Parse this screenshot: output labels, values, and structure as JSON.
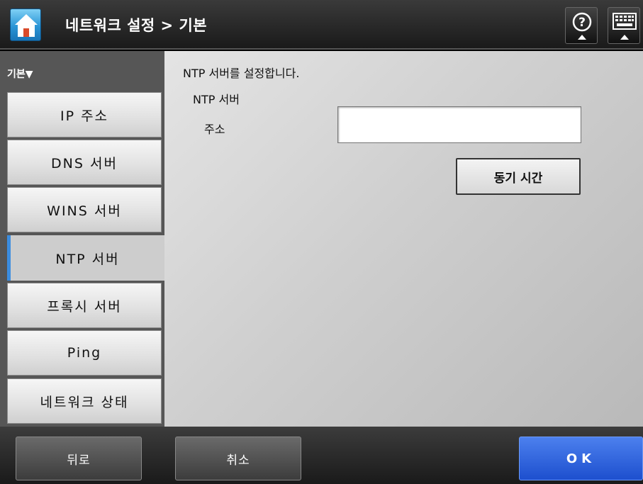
{
  "header": {
    "title": "네트워크 설정 > 기본",
    "home_icon": "home-icon",
    "help_icon": "help-icon",
    "keyboard_icon": "keyboard-icon"
  },
  "sidebar": {
    "heading": "기본▼",
    "items": [
      {
        "label": "IP 주소"
      },
      {
        "label": "DNS 서버"
      },
      {
        "label": "WINS 서버"
      },
      {
        "label": "NTP 서버",
        "active": true
      },
      {
        "label": "프록시 서버"
      },
      {
        "label": "Ping"
      },
      {
        "label": "네트워크 상태"
      }
    ]
  },
  "main": {
    "description": "NTP 서버를 설정합니다.",
    "section_label": "NTP 서버",
    "address_label": "주소",
    "address_value": "",
    "sync_button": "동기 시간"
  },
  "footer": {
    "back": "뒤로",
    "cancel": "취소",
    "ok": "OK"
  },
  "colors": {
    "accent": "#3b8de0",
    "ok_button": "#2a5fd9"
  }
}
